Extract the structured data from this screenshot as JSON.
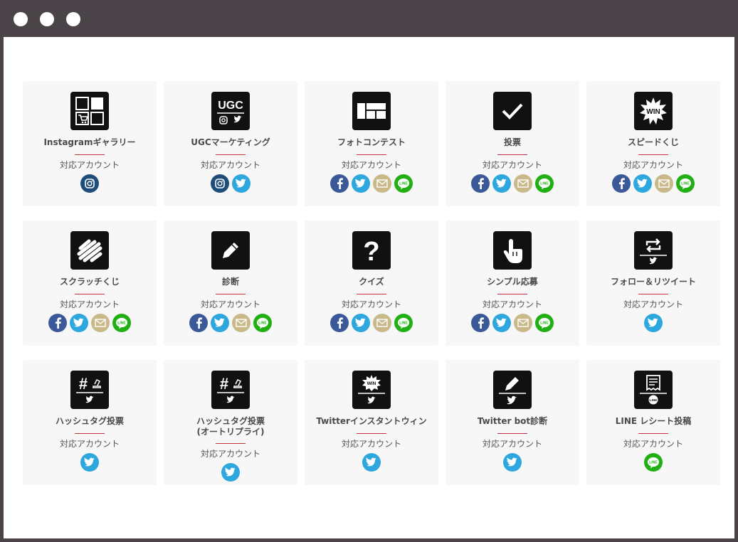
{
  "window": {
    "title": ""
  },
  "cards": [
    {
      "title": "Instagramギャラリー",
      "icon": "gallery-cart",
      "sub": "対応アカウント",
      "accounts": [
        "instagram"
      ]
    },
    {
      "title": "UGCマーケティング",
      "icon": "ugc",
      "icon_text": "UGC",
      "sub": "対応アカウント",
      "accounts": [
        "instagram",
        "twitter"
      ]
    },
    {
      "title": "フォトコンテスト",
      "icon": "photo-layout",
      "sub": "対応アカウント",
      "accounts": [
        "facebook",
        "twitter",
        "mail",
        "line"
      ]
    },
    {
      "title": "投票",
      "icon": "check",
      "sub": "対応アカウント",
      "accounts": [
        "facebook",
        "twitter",
        "mail",
        "line"
      ]
    },
    {
      "title": "スピードくじ",
      "icon": "win-burst",
      "icon_text": "WIN",
      "sub": "対応アカウント",
      "accounts": [
        "facebook",
        "twitter",
        "mail",
        "line"
      ]
    },
    {
      "title": "スクラッチくじ",
      "icon": "scribble",
      "sub": "対応アカウント",
      "accounts": [
        "facebook",
        "twitter",
        "mail",
        "line"
      ]
    },
    {
      "title": "診断",
      "icon": "pencil",
      "sub": "対応アカウント",
      "accounts": [
        "facebook",
        "twitter",
        "mail",
        "line"
      ]
    },
    {
      "title": "クイズ",
      "icon": "question",
      "icon_text": "?",
      "sub": "対応アカウント",
      "accounts": [
        "facebook",
        "twitter",
        "mail",
        "line"
      ]
    },
    {
      "title": "シンプル応募",
      "icon": "tap",
      "sub": "対応アカウント",
      "accounts": [
        "facebook",
        "twitter",
        "mail",
        "line"
      ]
    },
    {
      "title": "フォロー＆リツイート",
      "icon": "retweet",
      "sub": "対応アカウント",
      "accounts": [
        "twitter"
      ]
    },
    {
      "title": "ハッシュタグ投票",
      "icon": "hashtag-vote",
      "icon_text": "#",
      "sub": "対応アカウント",
      "accounts": [
        "twitter"
      ]
    },
    {
      "title": "ハッシュタグ投票\n(オートリプライ)",
      "icon": "hashtag-vote",
      "icon_text": "#",
      "sub": "対応アカウント",
      "accounts": [
        "twitter"
      ]
    },
    {
      "title": "Twitterインスタントウィン",
      "icon": "twitter-win",
      "icon_text": "WIN",
      "sub": "対応アカウント",
      "accounts": [
        "twitter"
      ]
    },
    {
      "title": "Twitter bot診断",
      "icon": "twitter-pencil",
      "sub": "対応アカウント",
      "accounts": [
        "twitter"
      ]
    },
    {
      "title": "LINE レシート投稿",
      "icon": "line-receipt",
      "icon_text": "LINE",
      "sub": "対応アカウント",
      "accounts": [
        "line"
      ]
    }
  ],
  "colors": {
    "instagram": "#1f4d7a",
    "facebook": "#3b5998",
    "twitter": "#2ea6de",
    "mail": "#c9b98a",
    "line": "#21b014",
    "accent_line": "#c8323c",
    "card_bg": "#f7f7f7",
    "frame": "#4a4348"
  },
  "account_labels": {
    "line": "LINE"
  }
}
